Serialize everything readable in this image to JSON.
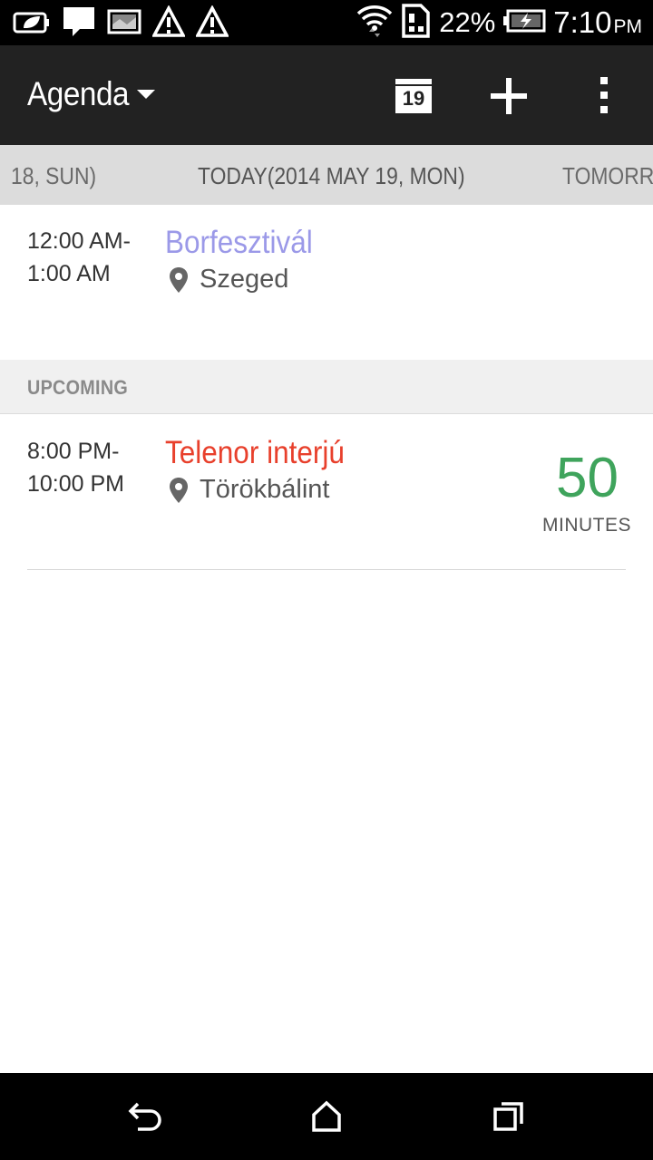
{
  "status_bar": {
    "battery_percent": "22%",
    "time": "7:10",
    "ampm": "PM",
    "left_icons": [
      "leaf-battery-icon",
      "message-icon",
      "image-icon",
      "alert-icon",
      "alert-icon"
    ],
    "right_icons": [
      "wifi-icon",
      "sim-icon",
      "battery-charging-icon"
    ]
  },
  "action_bar": {
    "title": "Agenda",
    "calendar_day": "19"
  },
  "day_strip": {
    "prev": "18, SUN)",
    "today": "TODAY(2014 MAY 19, MON)",
    "next": "TOMORROW"
  },
  "events": [
    {
      "time": "12:00 AM-\n1:00 AM",
      "title": "Borfesztivál",
      "location": "Szeged",
      "color": "#9b99e8"
    }
  ],
  "upcoming": {
    "header": "UPCOMING",
    "events": [
      {
        "time": "8:00 PM-\n10:00 PM",
        "title": "Telenor interjú",
        "location": "Törökbálint",
        "color": "#e8402c",
        "countdown_value": "50",
        "countdown_unit": "MINUTES",
        "countdown_color": "#3fa45c"
      }
    ]
  },
  "nav_bar": {
    "buttons": [
      "back-icon",
      "home-icon",
      "recent-apps-icon"
    ]
  }
}
